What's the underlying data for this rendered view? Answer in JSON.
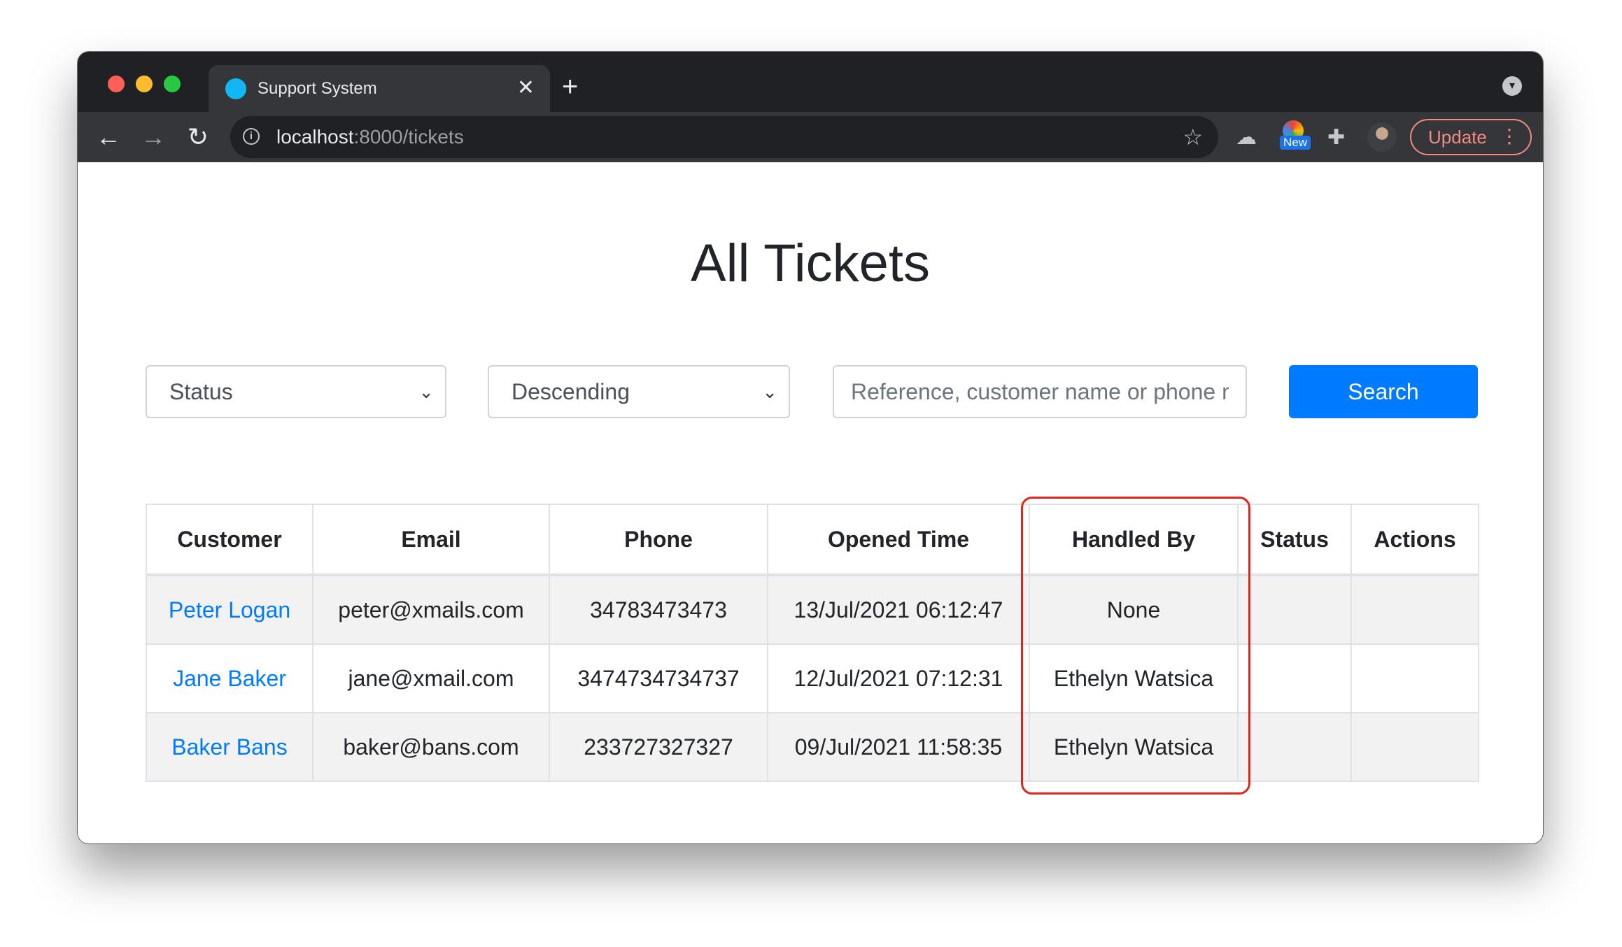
{
  "browser": {
    "tab_title": "Support System",
    "tab_close": "✕",
    "new_tab": "+",
    "url_host": "localhost",
    "url_rest": ":8000/tickets",
    "extension_badge": "New",
    "update_label": "Update"
  },
  "page": {
    "title": "All Tickets"
  },
  "filters": {
    "status_select": "Status",
    "order_select": "Descending",
    "search_placeholder": "Reference, customer name or phone number",
    "search_button": "Search"
  },
  "table": {
    "headers": [
      "Customer",
      "Email",
      "Phone",
      "Opened Time",
      "Handled By",
      "Status",
      "Actions"
    ],
    "rows": [
      {
        "customer": "Peter Logan",
        "email": "peter@xmails.com",
        "phone": "34783473473",
        "opened": "13/Jul/2021 06:12:47",
        "handled_by": "None",
        "status": "",
        "actions": ""
      },
      {
        "customer": "Jane Baker",
        "email": "jane@xmail.com",
        "phone": "3474734734737",
        "opened": "12/Jul/2021 07:12:31",
        "handled_by": "Ethelyn Watsica",
        "status": "",
        "actions": ""
      },
      {
        "customer": "Baker Bans",
        "email": "baker@bans.com",
        "phone": "233727327327",
        "opened": "09/Jul/2021 11:58:35",
        "handled_by": "Ethelyn Watsica",
        "status": "",
        "actions": ""
      }
    ]
  },
  "colors": {
    "primary": "#007bff",
    "highlight": "#e0261b",
    "chrome_dark": "#202124"
  },
  "icons": [
    "back-arrow-icon",
    "forward-arrow-icon",
    "reload-icon",
    "info-icon",
    "star-icon",
    "cloud-extension-icon",
    "puzzle-icon",
    "chevron-down-icon"
  ]
}
